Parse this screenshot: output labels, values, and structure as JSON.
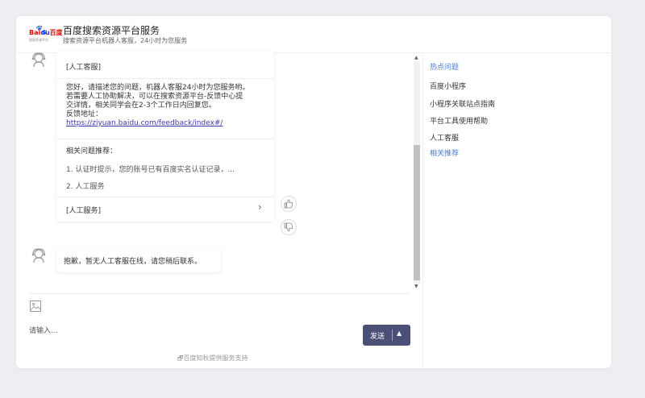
{
  "header": {
    "logo_text_red": "Bai",
    "logo_text_blue": "du",
    "logo_text_tail": "百度",
    "logo_sub": "搜索资源平台",
    "title": "百度搜索资源平台服务",
    "subtitle": "搜索资源平台机器人客服，24小时为您服务"
  },
  "messages": {
    "card": {
      "header": "[人工客服]",
      "body_lines": [
        "您好，请描述您的问题，机器人客服24小时为您服务哟。",
        "若需要人工协助解决，可以在搜索资源平台-反馈中心提",
        "交详情，相关同学会在2-3个工作日内回复您。",
        "反馈地址："
      ],
      "link": "https://ziyuan.baidu.com/feedback/index#/",
      "related_title": "相关问题推荐：",
      "related": [
        "1. 认证时提示，您的账号已有百度实名认证记录，...",
        "2. 人工服务"
      ],
      "footer": "[人工服务]"
    },
    "reply": "抱歉，暂无人工客服在线，请您稍后联系。"
  },
  "input": {
    "placeholder": "请输入...",
    "send_label": "发送",
    "powered_by": "百度知秋提供服务支持"
  },
  "sidebar": {
    "title": "热点问题",
    "items": [
      "百度小程序",
      "小程序关联站点指南",
      "平台工具使用帮助",
      "人工客服"
    ],
    "more": "相关推荐"
  },
  "colors": {
    "accent": "#4a7fd6",
    "send_button": "#4b5079",
    "link": "#3b3bb0"
  }
}
